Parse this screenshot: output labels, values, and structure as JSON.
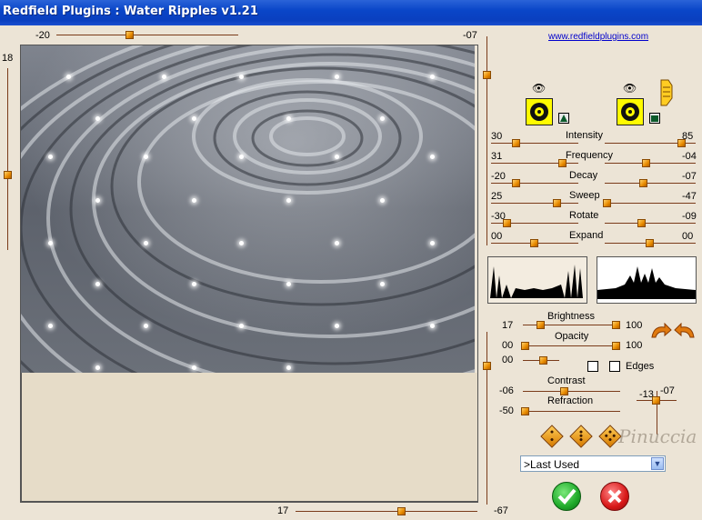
{
  "window": {
    "title": "Redfield Plugins : Water Ripples v1.21"
  },
  "link": "www.redfieldplugins.com",
  "preview": {
    "top_slider_value": "-20",
    "top_right_value": "-07",
    "left_slider_value": "18",
    "bottom_slider_value": "17",
    "bottom_right_value": "-67"
  },
  "params": [
    {
      "name": "Intensity",
      "left": "30",
      "right": "85"
    },
    {
      "name": "Frequency",
      "left": "31",
      "right": "-04"
    },
    {
      "name": "Decay",
      "left": "-20",
      "right": "-07"
    },
    {
      "name": "Sweep",
      "left": "25",
      "right": "-47"
    },
    {
      "name": "Rotate",
      "left": "-30",
      "right": "-09"
    },
    {
      "name": "Expand",
      "left": "00",
      "right": "00"
    }
  ],
  "lighting": {
    "brightness_label": "Brightness",
    "brightness_left": "17",
    "brightness_right": "100",
    "opacity_label": "Opacity",
    "opacity_left": "00",
    "opacity_right": "100",
    "third_left": "00",
    "edges_label": "Edges",
    "contrast_label": "Contrast",
    "contrast_left": "-06",
    "refraction_label": "Refraction",
    "refraction_left": "-50",
    "light_pos_left": "-13",
    "light_pos_right": "-07"
  },
  "preset": {
    "selected": ">Last Used"
  },
  "signature": "Pinuccia",
  "icons": {
    "ok": "ok-check-icon",
    "cancel": "cancel-x-icon",
    "eye": "eye-icon",
    "hand": "pointing-hand-icon",
    "dice": "random-dice-icon",
    "undo": "undo-arrow-icon",
    "redo": "redo-arrow-icon"
  },
  "colors": {
    "accent": "#e88a00",
    "title_bar": "#0a46c8",
    "ok": "#1faa2a",
    "cancel": "#d81818"
  }
}
